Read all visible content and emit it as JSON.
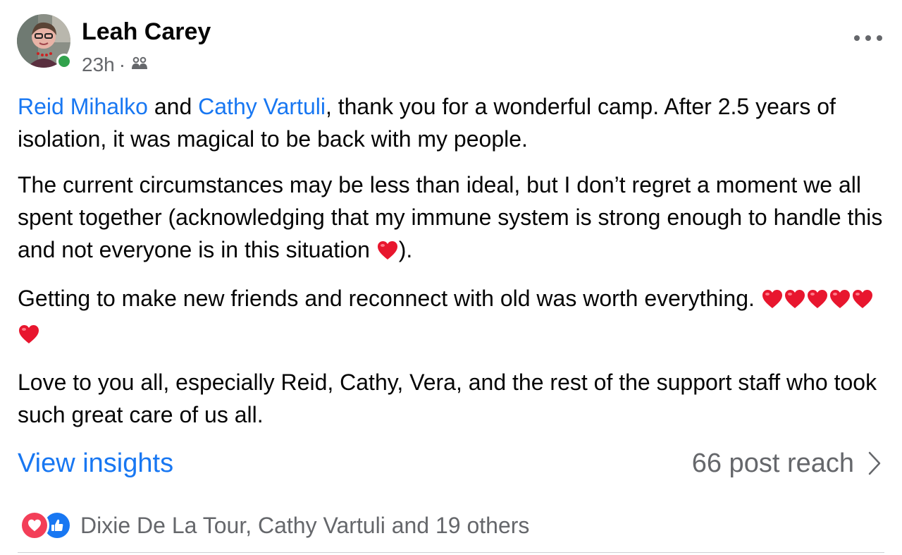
{
  "post": {
    "author": "Leah Carey",
    "time": "23h",
    "separator": "·",
    "audience_icon": "friends-icon",
    "online_status_color": "#31a24c"
  },
  "body": {
    "p1": {
      "mention1": "Reid Mihalko",
      "and": " and ",
      "mention2": "Cathy Vartuli",
      "rest": ", thank you for a wonderful camp. After 2.5 years of isolation, it was magical to be back with my people."
    },
    "p2": {
      "text": "The current circumstances may be less than ideal, but I don’t regret a moment we all spent together (acknowledging that my immune system is strong enough to handle this and not everyone is in this situation ",
      "tail": ")."
    },
    "p3": {
      "text": "Getting to make new friends and reconnect with old was worth everything. ",
      "heart_count": 6
    },
    "p4": {
      "text": "Love to you all, especially Reid, Cathy, Vera, and the rest of the support staff who took such great care of us all."
    }
  },
  "insights": {
    "link_label": "View insights",
    "reach_label": "66 post reach"
  },
  "reactions": {
    "types": [
      "love",
      "like"
    ],
    "text": "Dixie De La Tour, Cathy Vartuli and 19 others"
  },
  "colors": {
    "link": "#1877f2",
    "secondary_text": "#65676b",
    "heart": "#e8162e",
    "love_reaction": "#f33e58",
    "like_reaction": "#1877f2"
  }
}
